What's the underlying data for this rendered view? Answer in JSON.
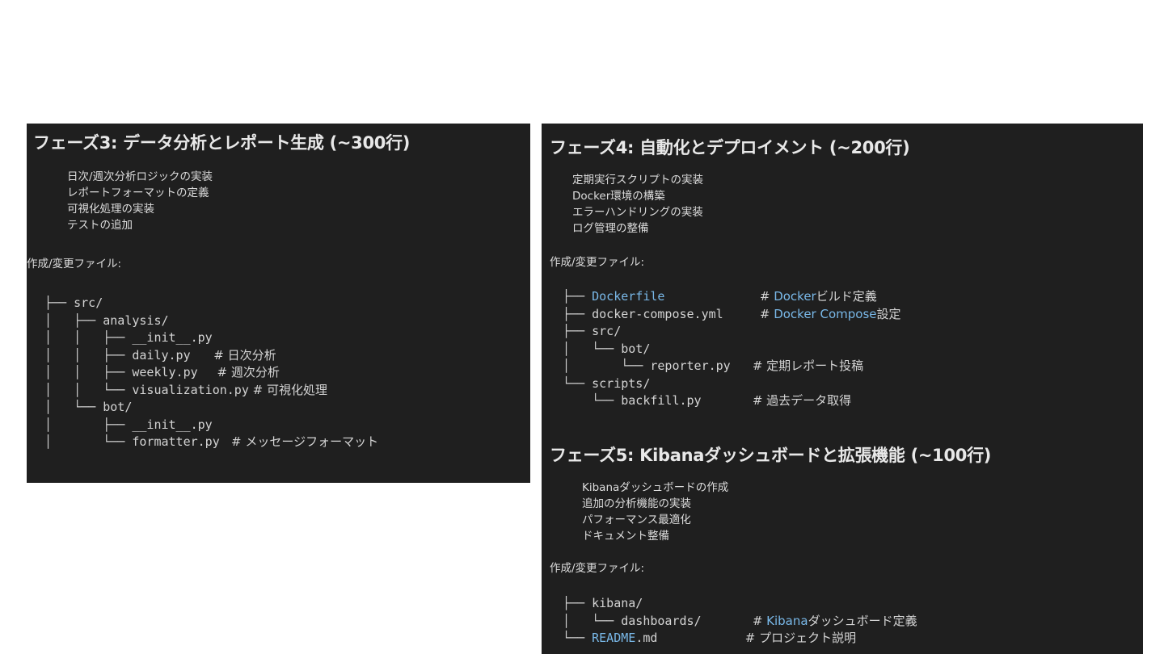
{
  "phase3": {
    "title": "フェーズ3: データ分析とレポート生成 (~300行)",
    "tasks": [
      "日次/週次分析ロジックの実装",
      "レポートフォーマットの定義",
      "可視化処理の実装",
      "テストの追加"
    ],
    "files_label": "作成/変更ファイル:",
    "tree": [
      {
        "prefix": "├── ",
        "name": "src/",
        "comment": ""
      },
      {
        "prefix": "│   ├── ",
        "name": "analysis/",
        "comment": ""
      },
      {
        "prefix": "│   │   ├── ",
        "name": "__init__.py",
        "comment": ""
      },
      {
        "prefix": "│   │   ├── ",
        "name": "daily.py",
        "comment": "      # 日次分析"
      },
      {
        "prefix": "│   │   ├── ",
        "name": "weekly.py",
        "comment": "     # 週次分析"
      },
      {
        "prefix": "│   │   └── ",
        "name": "visualization.py",
        "comment": " # 可視化処理"
      },
      {
        "prefix": "│   └── ",
        "name": "bot/",
        "comment": ""
      },
      {
        "prefix": "│       ├── ",
        "name": "__init__.py",
        "comment": ""
      },
      {
        "prefix": "│       └── ",
        "name": "formatter.py",
        "comment": "   # メッセージフォーマット"
      }
    ]
  },
  "phase4": {
    "title": "フェーズ4: 自動化とデプロイメント (~200行)",
    "tasks": [
      "定期実行スクリプトの実装",
      "Docker環境の構築",
      "エラーハンドリングの実装",
      "ログ管理の整備"
    ],
    "files_label": "作成/変更ファイル:",
    "tree": [
      {
        "prefix": "├── ",
        "name": "Dockerfile",
        "hl": true,
        "pad": "             ",
        "c_pre": "# ",
        "c_hl": "Docker",
        "c_post": "ビルド定義"
      },
      {
        "prefix": "├── ",
        "name": "docker-compose.yml",
        "hl": false,
        "pad": "     ",
        "c_pre": "# ",
        "c_hl": "Docker Compose",
        "c_post": "設定"
      },
      {
        "prefix": "├── ",
        "name": "src/",
        "hl": false,
        "pad": "",
        "c_pre": "",
        "c_hl": "",
        "c_post": ""
      },
      {
        "prefix": "│   └── ",
        "name": "bot/",
        "hl": false,
        "pad": "",
        "c_pre": "",
        "c_hl": "",
        "c_post": ""
      },
      {
        "prefix": "│       └── ",
        "name": "reporter.py",
        "hl": false,
        "pad": "   ",
        "c_pre": "# 定期レポート投稿",
        "c_hl": "",
        "c_post": ""
      },
      {
        "prefix": "└── ",
        "name": "scripts/",
        "hl": false,
        "pad": "",
        "c_pre": "",
        "c_hl": "",
        "c_post": ""
      },
      {
        "prefix": "    └── ",
        "name": "backfill.py",
        "hl": false,
        "pad": "       ",
        "c_pre": "# 過去データ取得",
        "c_hl": "",
        "c_post": ""
      }
    ]
  },
  "phase5": {
    "title": "フェーズ5: Kibanaダッシュボードと拡張機能 (~100行)",
    "tasks": [
      "Kibanaダッシュボードの作成",
      "追加の分析機能の実装",
      "パフォーマンス最適化",
      "ドキュメント整備"
    ],
    "files_label": "作成/変更ファイル:",
    "tree": [
      {
        "prefix": "├── ",
        "name": "kibana/",
        "hl": false,
        "pad": "",
        "c_pre": "",
        "c_hl": "",
        "c_post": ""
      },
      {
        "prefix": "│   └── ",
        "name": "dashboards/",
        "hl": false,
        "pad": "       ",
        "c_pre": "# ",
        "c_hl": "Kibana",
        "c_post": "ダッシュボード定義"
      },
      {
        "prefix": "└── ",
        "name": "README",
        "name_tail": ".md",
        "hl": true,
        "pad": "            ",
        "c_pre": "# プロジェクト説明",
        "c_hl": "",
        "c_post": ""
      }
    ]
  },
  "colors": {
    "panel_bg": "#1f1f1f",
    "text": "#d4d4d4",
    "highlight": "#79b8e8"
  }
}
